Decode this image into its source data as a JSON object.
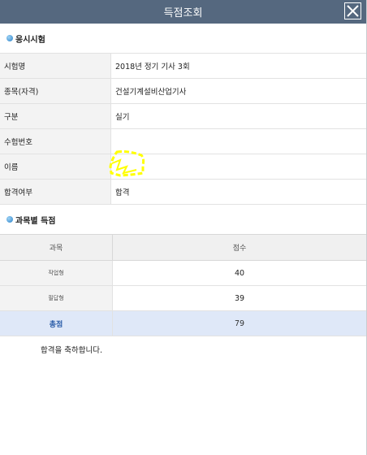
{
  "window": {
    "title": "득점조회"
  },
  "exam_section": {
    "heading": "응시시험",
    "rows": [
      {
        "label": "시험명",
        "value": "2018년 정기 기사 3회"
      },
      {
        "label": "종목(자격)",
        "value": "건설기계설비산업기사"
      },
      {
        "label": "구분",
        "value": "실기"
      },
      {
        "label": "수험번호",
        "value": ""
      },
      {
        "label": "이름",
        "value": ""
      },
      {
        "label": "합격여부",
        "value": "합격"
      }
    ]
  },
  "score_section": {
    "heading": "과목별 득점",
    "columns": [
      "과목",
      "점수"
    ],
    "rows": [
      {
        "subject": "작업형",
        "score": "40"
      },
      {
        "subject": "필답형",
        "score": "39"
      }
    ],
    "total": {
      "label": "총점",
      "score": "79"
    }
  },
  "message": "합격을 축하합니다.",
  "colors": {
    "titlebar": "#55687f",
    "total_row": "#dfe8f8",
    "highlight": "#ffff00"
  }
}
